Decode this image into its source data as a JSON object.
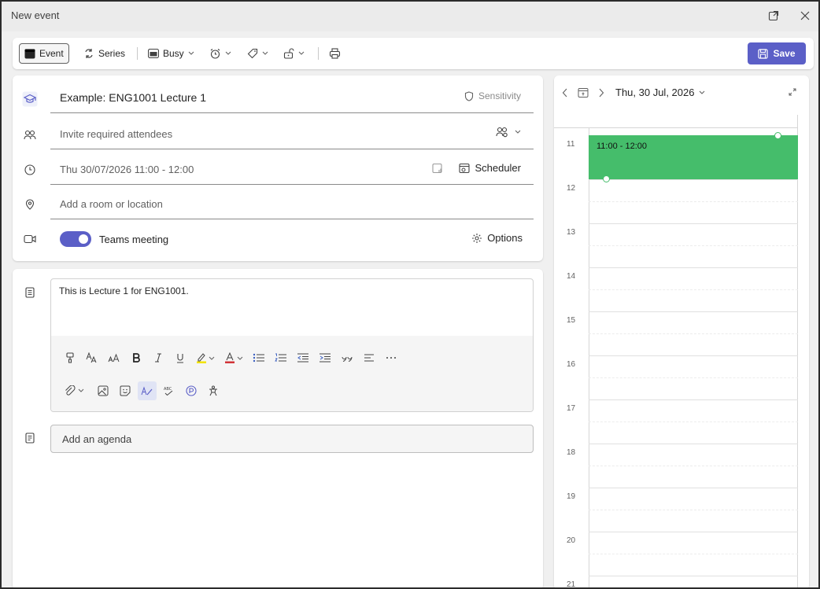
{
  "window": {
    "title": "New event"
  },
  "toolbar": {
    "event_label": "Event",
    "series_label": "Series",
    "busy_label": "Busy",
    "save_label": "Save"
  },
  "details": {
    "title_value": "Example: ENG1001 Lecture 1",
    "sensitivity_label": "Sensitivity",
    "attendees_placeholder": "Invite required attendees",
    "datetime_value": "Thu 30/07/2026 11:00 - 12:00",
    "scheduler_label": "Scheduler",
    "location_placeholder": "Add a room or location",
    "teams_meeting_label": "Teams meeting",
    "teams_meeting_on": true,
    "options_label": "Options"
  },
  "body": {
    "text": "This is Lecture 1 for ENG1001.",
    "agenda_placeholder": "Add an agenda"
  },
  "calendar": {
    "date_label": "Thu, 30 Jul, 2026",
    "hours": [
      "11",
      "12",
      "13",
      "14",
      "15",
      "16",
      "17",
      "18",
      "19",
      "20",
      "21"
    ],
    "event_time": "11:00 - 12:00",
    "event_color": "#45bd6b"
  },
  "colors": {
    "accent": "#5b5fc7",
    "event": "#45bd6b"
  }
}
